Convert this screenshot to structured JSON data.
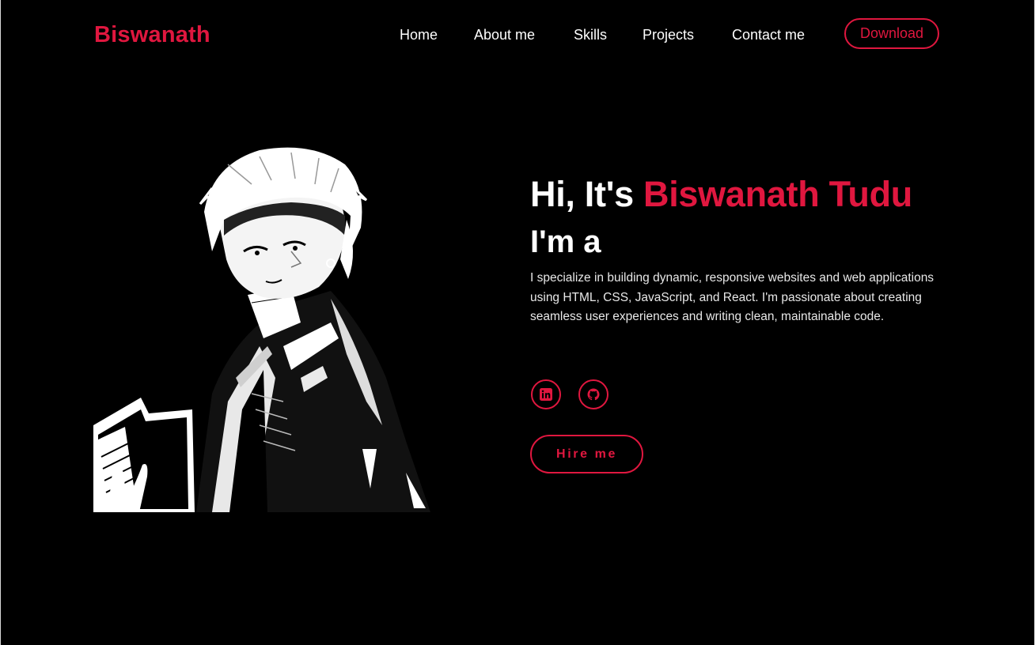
{
  "header": {
    "logo": "Biswanath",
    "nav": [
      {
        "label": "Home"
      },
      {
        "label": "About me"
      },
      {
        "label": "Skills"
      },
      {
        "label": "Projects"
      },
      {
        "label": "Contact me"
      }
    ],
    "download_label": "Download"
  },
  "hero": {
    "greeting_prefix": "Hi, It's ",
    "name": "Biswanath Tudu",
    "role_prefix": "I'm a",
    "intro": "I specialize in building dynamic, responsive websites and web applications using HTML, CSS, JavaScript, and React. I'm passionate about creating seamless user experiences and writing clean, maintainable code.",
    "social_icons": [
      "linkedin-icon",
      "github-icon"
    ],
    "hire_label": "Hire me"
  },
  "colors": {
    "accent": "#e0173f",
    "background": "#000000",
    "text": "#ffffff"
  }
}
